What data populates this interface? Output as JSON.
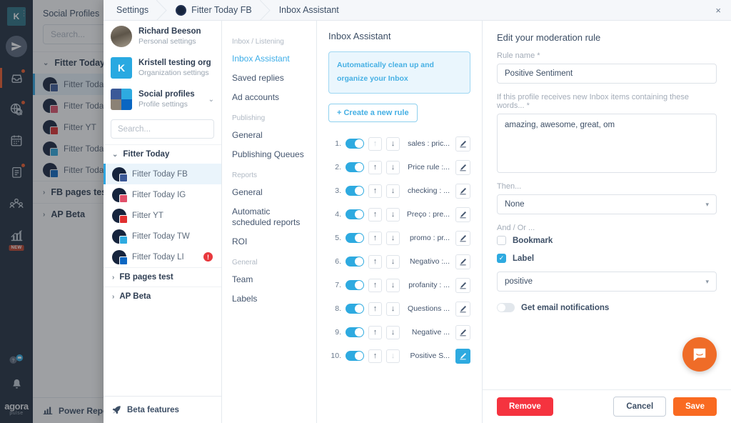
{
  "rail": {
    "avatar_initial": "K",
    "menu_dots": "⋮",
    "items": [
      {
        "name": "publish-icon",
        "badge": false
      },
      {
        "name": "inbox-icon",
        "badge": true
      },
      {
        "name": "listening-icon",
        "badge": true
      },
      {
        "name": "calendar-icon",
        "badge": false
      },
      {
        "name": "reports-icon",
        "badge": true
      },
      {
        "name": "team-icon",
        "badge": false
      },
      {
        "name": "analytics-icon",
        "badge": false,
        "new_badge": "NEW"
      }
    ],
    "new_badge": "NEW",
    "help_icon": "?",
    "bell_icon": "bell",
    "logo_line1": "agora",
    "logo_line2": "pulse"
  },
  "background": {
    "panel_title": "Social Profiles",
    "search_placeholder": "Search...",
    "group_label": "Fitter Today",
    "profiles": [
      {
        "name": "Fitter Today FB",
        "network": "fb"
      },
      {
        "name": "Fitter Today IG",
        "network": "ig"
      },
      {
        "name": "Fitter YT",
        "network": "yt"
      },
      {
        "name": "Fitter Today TW",
        "network": "tw"
      },
      {
        "name": "Fitter Today LI",
        "network": "li"
      }
    ],
    "groups": [
      "FB pages test",
      "AP Beta"
    ],
    "footer_label": "Power Report"
  },
  "modal": {
    "breadcrumbs": [
      {
        "label": "Settings",
        "has_avatar": false
      },
      {
        "label": "Fitter Today FB",
        "has_avatar": true
      },
      {
        "label": "Inbox Assistant",
        "has_avatar": false
      }
    ],
    "close_label": "×",
    "accounts": [
      {
        "title": "Richard Beeson",
        "subtitle": "Personal settings",
        "avatar_type": "photo"
      },
      {
        "title": "Kristell testing org",
        "subtitle": "Organization settings",
        "avatar_type": "initial",
        "initial": "K"
      },
      {
        "title": "Social profiles",
        "subtitle": "Profile settings",
        "avatar_type": "networks",
        "chevron": "⌄"
      }
    ],
    "search_placeholder": "Search...",
    "profile_group": "Fitter Today",
    "profiles": [
      {
        "name": "Fitter Today FB",
        "network": "fb",
        "selected": true,
        "error": false
      },
      {
        "name": "Fitter Today IG",
        "network": "ig",
        "selected": false,
        "error": false
      },
      {
        "name": "Fitter YT",
        "network": "yt",
        "selected": false,
        "error": false
      },
      {
        "name": "Fitter Today TW",
        "network": "tw",
        "selected": false,
        "error": false
      },
      {
        "name": "Fitter Today LI",
        "network": "li",
        "selected": false,
        "error": true
      }
    ],
    "error_badge": "!",
    "collapsed_groups": [
      "FB pages test",
      "AP Beta"
    ],
    "beta_label": "Beta features"
  },
  "settings_nav": [
    {
      "heading": "Inbox / Listening",
      "links": [
        {
          "label": "Inbox Assistant",
          "active": true
        },
        {
          "label": "Saved replies",
          "active": false
        },
        {
          "label": "Ad accounts",
          "active": false
        }
      ]
    },
    {
      "heading": "Publishing",
      "links": [
        {
          "label": "General",
          "active": false
        },
        {
          "label": "Publishing Queues",
          "active": false
        }
      ]
    },
    {
      "heading": "Reports",
      "links": [
        {
          "label": "General",
          "active": false
        },
        {
          "label": "Automatic scheduled reports",
          "active": false
        },
        {
          "label": "ROI",
          "active": false
        }
      ]
    },
    {
      "heading": "General",
      "links": [
        {
          "label": "Team",
          "active": false
        },
        {
          "label": "Labels",
          "active": false
        }
      ]
    }
  ],
  "rules_panel": {
    "title": "Inbox Assistant",
    "info_text": "Automatically clean up and organize your Inbox",
    "create_button": "+ Create a new rule",
    "up_arrow": "↑",
    "down_arrow": "↓",
    "rules": [
      {
        "num": "1.",
        "enabled": true,
        "name": "sales : pric...",
        "up_disabled": true,
        "down_disabled": false,
        "editing": false
      },
      {
        "num": "2.",
        "enabled": true,
        "name": "Price rule :...",
        "up_disabled": false,
        "down_disabled": false,
        "editing": false
      },
      {
        "num": "3.",
        "enabled": true,
        "name": "checking : ...",
        "up_disabled": false,
        "down_disabled": false,
        "editing": false
      },
      {
        "num": "4.",
        "enabled": true,
        "name": "Preço : pre...",
        "up_disabled": false,
        "down_disabled": false,
        "editing": false
      },
      {
        "num": "5.",
        "enabled": true,
        "name": "promo : pr...",
        "up_disabled": false,
        "down_disabled": false,
        "editing": false
      },
      {
        "num": "6.",
        "enabled": true,
        "name": "Negativo :...",
        "up_disabled": false,
        "down_disabled": false,
        "editing": false
      },
      {
        "num": "7.",
        "enabled": true,
        "name": "profanity : ...",
        "up_disabled": false,
        "down_disabled": false,
        "editing": false
      },
      {
        "num": "8.",
        "enabled": true,
        "name": "Questions ...",
        "up_disabled": false,
        "down_disabled": false,
        "editing": false
      },
      {
        "num": "9.",
        "enabled": true,
        "name": "Negative ...",
        "up_disabled": false,
        "down_disabled": false,
        "editing": false
      },
      {
        "num": "10.",
        "enabled": true,
        "name": "Positive S...",
        "up_disabled": false,
        "down_disabled": true,
        "editing": true
      }
    ]
  },
  "form": {
    "title": "Edit your moderation rule",
    "rule_name_label": "Rule name *",
    "rule_name_value": "Positive Sentiment",
    "words_label": "If this profile receives new Inbox items containing these words... *",
    "words_value": "amazing, awesome, great, om",
    "then_label": "Then...",
    "then_value": "None",
    "andor_label": "And / Or ...",
    "bookmark_label": "Bookmark",
    "bookmark_checked": false,
    "label_label": "Label",
    "label_checked": true,
    "check_glyph": "✓",
    "label_value": "positive",
    "caret": "▾",
    "email_notifications_label": "Get email notifications",
    "email_notifications_on": false,
    "remove_button": "Remove",
    "cancel_button": "Cancel",
    "save_button": "Save"
  },
  "intercom": {
    "name": "chat-widget"
  },
  "colors": {
    "accent_blue": "#2eaae0",
    "orange": "#f96a21",
    "red": "#f5333f",
    "dark_navy": "#1f2d3d"
  }
}
